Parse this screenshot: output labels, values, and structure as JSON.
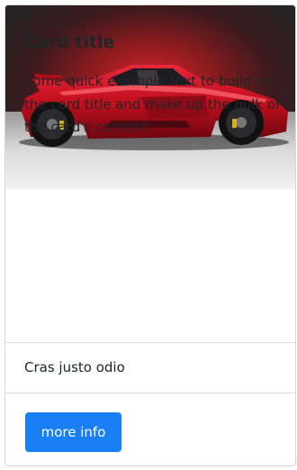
{
  "card": {
    "image": {
      "icon": "red-sports-car-image"
    },
    "title": "Card title",
    "text": "Some quick example text to build on the card title and make up the bulk of the card's content.",
    "list_items": [
      "Cras justo odio"
    ],
    "button_label": "more info"
  },
  "colors": {
    "button_bg": "#1a7ef5",
    "button_text": "#ffffff",
    "border": "#d5d5d5",
    "car_red": "#c8101c"
  }
}
